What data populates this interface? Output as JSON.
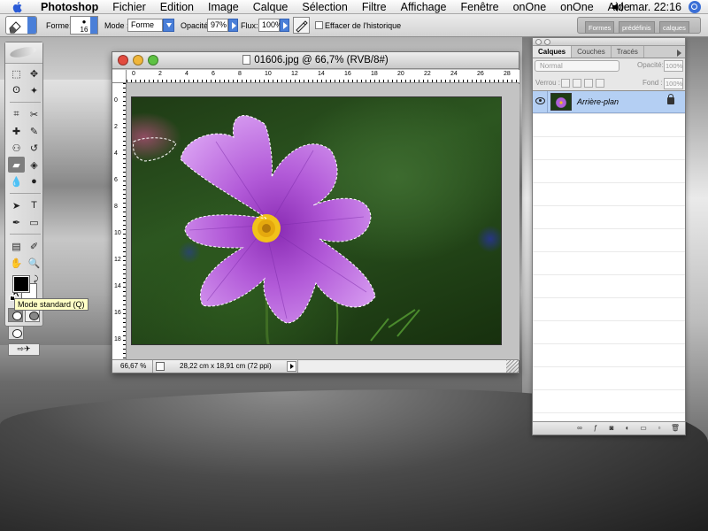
{
  "menubar": {
    "app_name": "Photoshop",
    "items": [
      "Fichier",
      "Edition",
      "Image",
      "Calque",
      "Sélection",
      "Filtre",
      "Affichage",
      "Fenêtre",
      "onOne",
      "onOne",
      "Aide"
    ],
    "clock": "mar. 22:16",
    "icons": [
      "apple-icon",
      "volume-icon",
      "spotlight-icon"
    ]
  },
  "options": {
    "forme_label": "Forme:",
    "brush_size": "16",
    "mode_label": "Mode :",
    "mode_value": "Forme",
    "opacity_label": "Opacité:",
    "opacity_value": "97%",
    "flux_label": "Flux:",
    "flux_value": "100%",
    "history_label": "Effacer de l'historique",
    "well_tabs": [
      "Formes",
      "prédéfinis",
      "calques"
    ]
  },
  "toolbox": {
    "tooltip": "Mode standard (Q)",
    "tools": [
      "marquee-icon",
      "move-icon",
      "lasso-icon",
      "magic-wand-icon",
      "crop-icon",
      "slice-icon",
      "healing-brush-icon",
      "brush-icon",
      "clone-stamp-icon",
      "history-brush-icon",
      "eraser-icon",
      "paint-bucket-icon",
      "blur-icon",
      "dodge-icon",
      "path-selection-icon",
      "type-icon",
      "pen-icon",
      "shape-icon",
      "notes-icon",
      "eyedropper-icon",
      "hand-icon",
      "zoom-icon"
    ],
    "tool_glyphs": [
      "⬚",
      "✥",
      "ʘ",
      "✦",
      "⌗",
      "✂",
      "✚",
      "✎",
      "⚇",
      "↺",
      "▰",
      "◈",
      "💧",
      "●",
      "➤",
      "T",
      "✒",
      "▭",
      "▤",
      "✐",
      "✋",
      "🔍"
    ],
    "foreground_color": "#000000",
    "background_color": "#ffffff"
  },
  "document": {
    "title": "01606.jpg @ 66,7% (RVB/8#)",
    "zoom": "66,67 %",
    "info": "28,22 cm x 18,91 cm (72 ppi)",
    "ruler_h": [
      "0",
      "2",
      "4",
      "6",
      "8",
      "10",
      "12",
      "14",
      "16",
      "18",
      "20",
      "22",
      "24",
      "26",
      "28"
    ],
    "ruler_v": [
      "0",
      "2",
      "4",
      "6",
      "8",
      "10",
      "12",
      "14",
      "16",
      "18"
    ],
    "colors": {
      "petal": "#b25ad8",
      "center": "#f2c21a",
      "background": "#2c5620"
    }
  },
  "layers_palette": {
    "tabs": [
      "Calques",
      "Couches",
      "Tracés"
    ],
    "blend_mode": "Normal",
    "opacity_label": "Opacité:",
    "opacity_value": "100%",
    "lock_label": "Verrou :",
    "fill_label": "Fond :",
    "fill_value": "100%",
    "layers": [
      {
        "name": "Arrière-plan",
        "visible": true,
        "locked": true,
        "selected": true
      }
    ],
    "bottom_buttons": [
      "link-icon",
      "fx-icon",
      "mask-icon",
      "adjustment-icon",
      "group-icon",
      "new-layer-icon",
      "trash-icon"
    ],
    "bottom_glyphs": [
      "∞",
      "ƒ",
      "◙",
      "◐",
      "▭",
      "▫",
      "🗑"
    ]
  }
}
